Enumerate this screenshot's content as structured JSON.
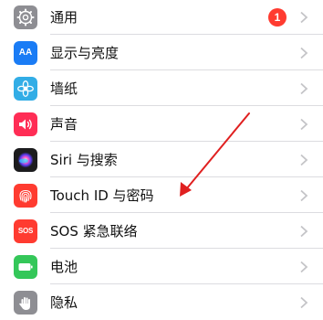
{
  "settings": {
    "rows": [
      {
        "label": "通用",
        "icon": "gear-icon",
        "color": "#8e8e93",
        "badge": "1"
      },
      {
        "label": "显示与亮度",
        "icon": "aa-icon",
        "icon_text": "AA",
        "color": "#1a7cf5"
      },
      {
        "label": "墙纸",
        "icon": "flower-icon",
        "color": "#32ade6"
      },
      {
        "label": "声音",
        "icon": "speaker-icon",
        "color": "#ff2d55"
      },
      {
        "label": "Siri 与搜索",
        "icon": "siri-icon",
        "color": "#1c1c1e"
      },
      {
        "label": "Touch ID 与密码",
        "icon": "fingerprint-icon",
        "color": "#ff3b30"
      },
      {
        "label": "SOS 紧急联络",
        "icon": "sos-icon",
        "icon_text": "SOS",
        "color": "#ff3b30"
      },
      {
        "label": "电池",
        "icon": "battery-icon",
        "color": "#34c759"
      },
      {
        "label": "隐私",
        "icon": "hand-icon",
        "color": "#8e8e93"
      }
    ]
  },
  "annotation": {
    "arrow_color": "#e02020"
  }
}
